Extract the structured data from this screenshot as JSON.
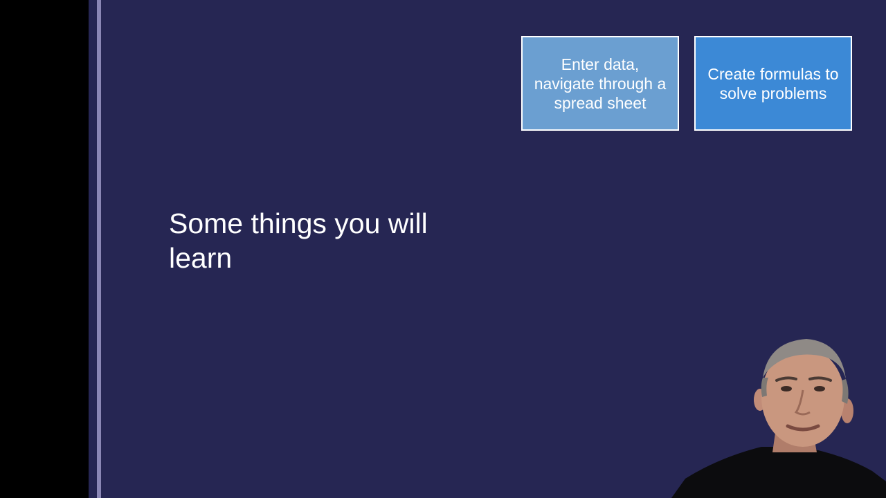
{
  "slide": {
    "title": "Some things you will learn",
    "cards": [
      {
        "label": "Enter data, navigate through a spread sheet"
      },
      {
        "label": "Create formulas to solve problems"
      }
    ]
  },
  "colors": {
    "slide_background": "#262653",
    "card_1": "#6b9fd1",
    "card_2": "#3c89d6",
    "accent_rule": "#8b87b5"
  },
  "presenter": {
    "icon": "presenter-webcam-image"
  }
}
